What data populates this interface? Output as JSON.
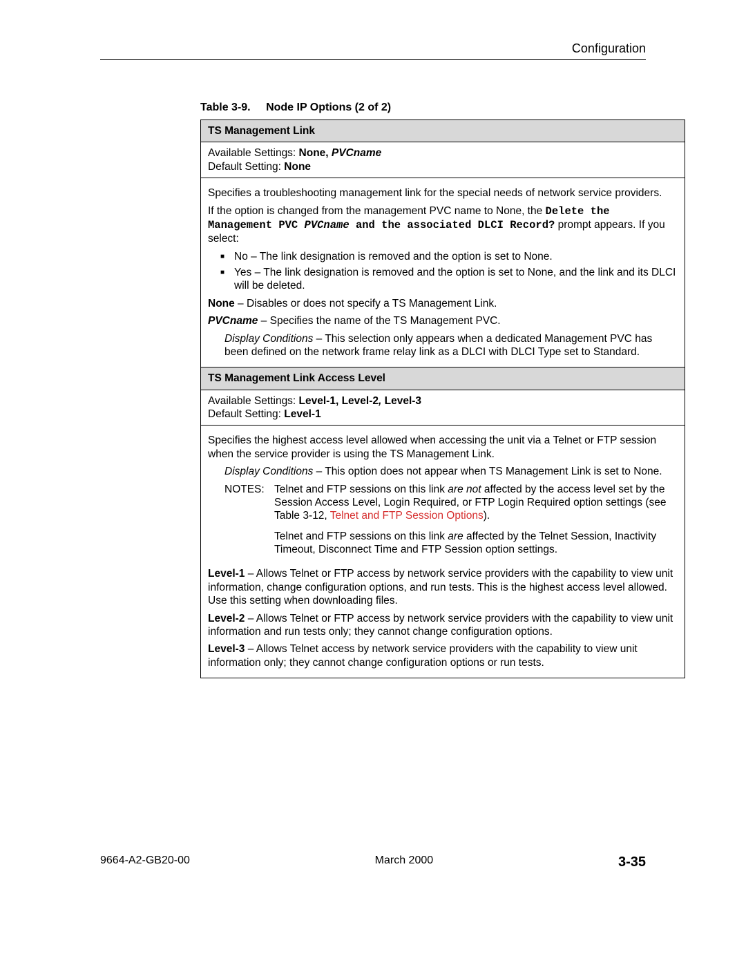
{
  "header": {
    "section": "Configuration"
  },
  "table": {
    "caption_number": "Table 3-9.",
    "caption_title": "Node IP Options (2 of 2)",
    "row1": {
      "header": "TS Management Link",
      "avail_label": "Available Settings: ",
      "avail_v1": "None, ",
      "avail_v2": "PVCname",
      "default_label": "Default Setting: ",
      "default_value": "None",
      "desc": "Specifies a troubleshooting management link for the special needs of network service providers.",
      "change_pre": "If the option is changed from the management PVC name to None, the ",
      "change_code1": "Delete the Management PVC ",
      "change_code2": "PVCname",
      "change_code3": " and the associated DLCI Record?",
      "change_post": " prompt appears. If you select:",
      "bullet_no": "No – The link designation is removed and the option is set to None.",
      "bullet_yes": "Yes – The link designation is removed and the option is set to None, and the link and its DLCI will be deleted.",
      "none_label": "None",
      "none_text": " – Disables or does not specify a TS Management Link.",
      "pvcname_label": "PVCname",
      "pvcname_text": " – Specifies the name of the TS Management PVC.",
      "disp_cond_label": "Display Conditions",
      "disp_cond_text": " – This selection only appears when a dedicated Management PVC has been defined on the network frame relay link as a DLCI with DLCI Type set to Standard."
    },
    "row2": {
      "header": "TS Management Link Access Level",
      "avail_label": "Available Settings: ",
      "avail_v1": "Level-1, Level-2",
      "avail_sep": ", ",
      "avail_v2": "Level-3",
      "default_label": "Default Setting: ",
      "default_value": "Level-1",
      "desc": "Specifies the highest access level allowed when accessing the unit via a Telnet or FTP session when the service provider is using the TS Management Link.",
      "disp_cond_label": "Display Conditions",
      "disp_cond_text": " – This option does not appear when TS Management Link is set to None.",
      "notes_label": "NOTES:",
      "note1_pre": "Telnet and FTP sessions on this link ",
      "note1_em": "are not",
      "note1_mid": " affected by the access level set by the Session Access Level, Login Required, or FTP Login Required option settings (see Table 3-12, ",
      "note1_link": "Telnet and FTP Session Options",
      "note1_post": ").",
      "note2_pre": "Telnet and FTP sessions on this link ",
      "note2_em": "are",
      "note2_post": " affected by the Telnet Session, Inactivity Timeout, Disconnect Time and FTP Session option settings.",
      "l1_label": "Level-1",
      "l1_text": " – Allows Telnet or FTP access by network service providers with the capability to view unit information, change configuration options, and run tests. This is the highest access level allowed. Use this setting when downloading files.",
      "l2_label": "Level-2",
      "l2_text": " – Allows Telnet or FTP access by network service providers with the capability to view unit information and run tests only; they cannot change configuration options.",
      "l3_label": "Level-3",
      "l3_text": " – Allows Telnet access by network service providers with the capability to view unit information only; they cannot change configuration options or run tests."
    }
  },
  "footer": {
    "doc_id": "9664-A2-GB20-00",
    "date": "March 2000",
    "page": "3-35"
  }
}
